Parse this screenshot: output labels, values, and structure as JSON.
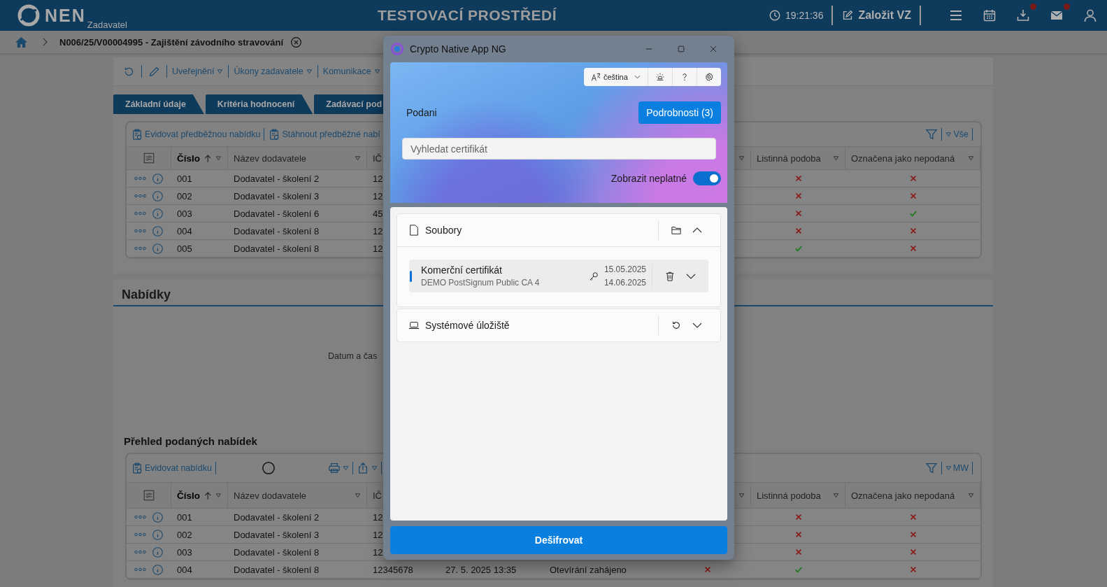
{
  "header": {
    "logo": "NEN",
    "logo_sub": "Zadavatel",
    "environment": "TESTOVACÍ PROSTŘEDÍ",
    "time": "19:21:36",
    "create_button": "Založit VZ",
    "downloads_badge": true,
    "mail_badge": true
  },
  "breadcrumb": {
    "title": "N006/25/V00004995 - Zajištění závodního stravování"
  },
  "toolbar": {
    "menus": [
      "Uveřejnění",
      "Úkony zadavatele",
      "Komunikace"
    ]
  },
  "tabs": [
    {
      "label": "Základní údaje",
      "selected": false
    },
    {
      "label": "Kritéria hodnocení",
      "selected": false
    },
    {
      "label": "Zadávací pod",
      "selected": false
    }
  ],
  "preliminary": {
    "actions": [
      "Evidovat předběžnou nabídku",
      "Stáhnout předběžné nabí"
    ],
    "filter_label": "Vše",
    "columns": [
      {
        "label": "Číslo",
        "sorted": true
      },
      {
        "label": "Název dodavatele"
      },
      {
        "label": "IČ"
      },
      {
        "label": "Listinná podoba"
      },
      {
        "label": "Označena jako nepodaná"
      }
    ],
    "rows": [
      {
        "number": "001",
        "supplier": "Dodavatel - školení 2",
        "ico": "12",
        "paper": false,
        "not_submitted": false
      },
      {
        "number": "002",
        "supplier": "Dodavatel - školení 3",
        "ico": "12",
        "paper": false,
        "not_submitted": false
      },
      {
        "number": "003",
        "supplier": "Dodavatel - školení 6",
        "ico": "45",
        "paper": false,
        "not_submitted": true
      },
      {
        "number": "004",
        "supplier": "Dodavatel - školení 8",
        "ico": "12",
        "paper": false,
        "not_submitted": false
      },
      {
        "number": "005",
        "supplier": "Dodavatel - školení 8",
        "ico": "12",
        "paper": true,
        "not_submitted": false
      }
    ]
  },
  "offers": {
    "title": "Nabídky",
    "note": "Datum a čas"
  },
  "submitted": {
    "title": "Přehled podaných nabídek",
    "action": "Evidovat nabídku",
    "filter_label": "MW",
    "columns": [
      {
        "label": "Číslo",
        "sorted": true
      },
      {
        "label": "Název dodavatele"
      },
      {
        "label": "IČ"
      },
      {
        "label": "Listinná podoba"
      },
      {
        "label": "Označena jako nepodaná"
      }
    ],
    "rows": [
      {
        "number": "001",
        "supplier": "Dodavatel - školení 2",
        "ico": "12",
        "paper": false,
        "not_submitted": false
      },
      {
        "number": "002",
        "supplier": "Dodavatel - školení 3",
        "ico": "12",
        "paper": false,
        "not_submitted": false
      },
      {
        "number": "003",
        "supplier": "Dodavatel - školení 8",
        "ico": "12",
        "paper": false,
        "not_submitted": false
      },
      {
        "number": "004",
        "supplier": "Dodavatel - školení 8",
        "ico": "12345678",
        "date": "27. 5. 2025 13:35",
        "state": "Otevírání zahájeno",
        "column_7": false,
        "paper": true,
        "not_submitted": false
      }
    ]
  },
  "modal": {
    "title": "Crypto Native App NG",
    "language": "čeština",
    "section_label": "Podani",
    "details_button": "Podrobnosti (3)",
    "search_placeholder": "Vyhledat certifikát",
    "show_invalid": {
      "label": "Zobrazit neplatné",
      "on": true
    },
    "groups": [
      {
        "kind": "files",
        "title": "Soubory",
        "expanded": true,
        "certificates": [
          {
            "name": "Komerční certifikát",
            "issuer": "DEMO PostSignum Public CA 4",
            "valid_from": "15.05.2025",
            "valid_to": "14.06.2025",
            "selected": true
          }
        ]
      },
      {
        "kind": "system",
        "title": "Systémové úložiště",
        "expanded": false
      }
    ],
    "primary_button": "Dešifrovat"
  }
}
